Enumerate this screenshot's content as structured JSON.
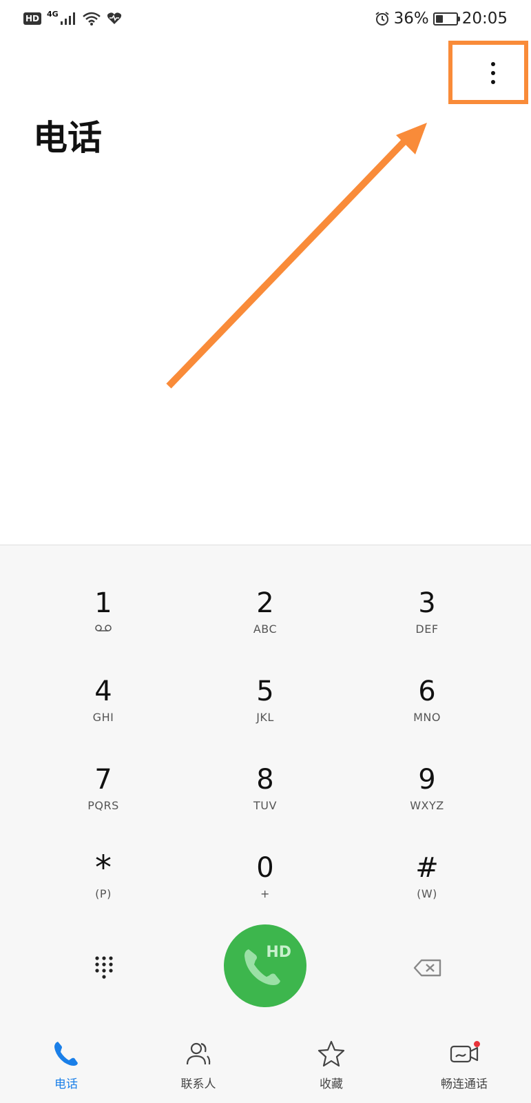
{
  "status_bar": {
    "hd_badge": "HD",
    "network": "4G",
    "battery_percent": "36%",
    "battery_level": 0.36,
    "time": "20:05",
    "icons": [
      "signal-icon",
      "wifi-icon",
      "heart-monitor-icon",
      "alarm-icon",
      "battery-icon"
    ]
  },
  "header": {
    "title": "电话"
  },
  "more_button": {
    "icon": "more-vert-icon"
  },
  "annotation": {
    "color": "#F98B39"
  },
  "keypad": {
    "keys": [
      {
        "num": "1",
        "sub": ""
      },
      {
        "num": "2",
        "sub": "ABC"
      },
      {
        "num": "3",
        "sub": "DEF"
      },
      {
        "num": "4",
        "sub": "GHI"
      },
      {
        "num": "5",
        "sub": "JKL"
      },
      {
        "num": "6",
        "sub": "MNO"
      },
      {
        "num": "7",
        "sub": "PQRS"
      },
      {
        "num": "8",
        "sub": "TUV"
      },
      {
        "num": "9",
        "sub": "WXYZ"
      },
      {
        "num": "*",
        "sub": "(P)"
      },
      {
        "num": "0",
        "sub": "+"
      },
      {
        "num": "#",
        "sub": "(W)"
      }
    ],
    "voicemail_icon": "voicemail-icon",
    "call_button_badge": "HD",
    "call_color": "#3DB64D"
  },
  "tabs": [
    {
      "label": "电话",
      "icon": "phone-icon",
      "active": true
    },
    {
      "label": "联系人",
      "icon": "contacts-icon",
      "active": false
    },
    {
      "label": "收藏",
      "icon": "star-icon",
      "active": false
    },
    {
      "label": "畅连通话",
      "icon": "video-call-icon",
      "active": false
    }
  ],
  "accent": "#1A7FE8"
}
